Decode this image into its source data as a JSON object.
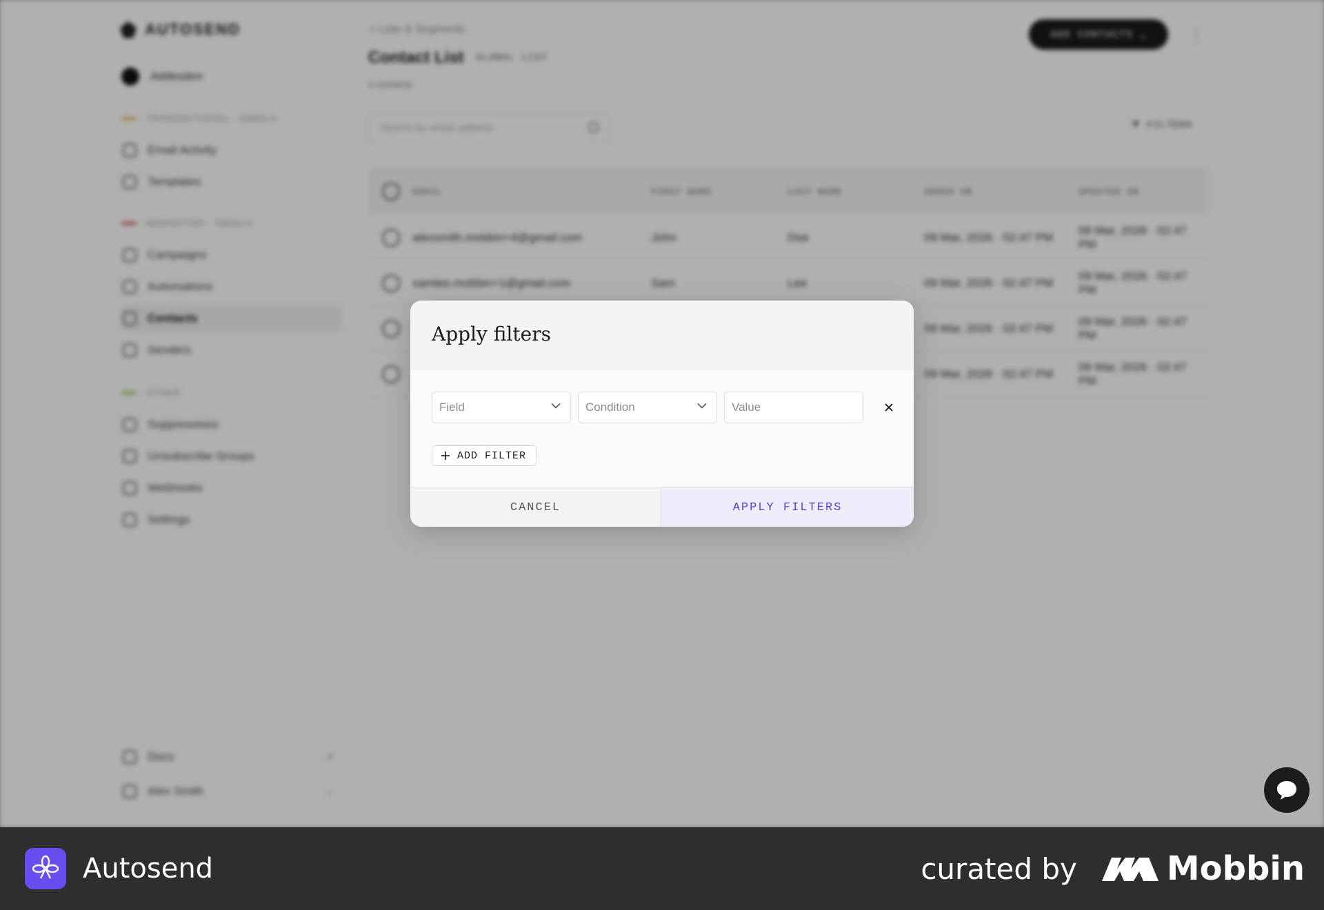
{
  "background": {
    "logo_text": "AUTOSEND",
    "user_name": "Addesdon",
    "sections": [
      {
        "label": "TRANSACTIONAL · EMAILS",
        "color": "#e0b340"
      },
      {
        "label": "MARKETING · EMAILS",
        "color": "#e04a4a"
      },
      {
        "label": "OTHER",
        "color": "#8bc34a"
      }
    ],
    "nav": [
      {
        "label": "Email Activity"
      },
      {
        "label": "Templates"
      },
      {
        "label": "Campaigns"
      },
      {
        "label": "Automations"
      },
      {
        "label": "Contacts"
      },
      {
        "label": "Senders"
      },
      {
        "label": "Suppressions"
      },
      {
        "label": "Unsubscribe Groups"
      },
      {
        "label": "Webhooks"
      },
      {
        "label": "Settings"
      }
    ],
    "bottom_nav": [
      {
        "label": "Docs",
        "badge": "↗"
      },
      {
        "label": "Alex Smith",
        "badge": "⌄"
      }
    ],
    "breadcrumb": "< Lists & Segments",
    "page_title": "Contact List",
    "title_tag": "GLOBAL LIST",
    "count_text": "4 contacts",
    "add_contacts_label": "ADD CONTACTS",
    "search_placeholder": "Search by email address",
    "filters_label": "FILTERS",
    "columns": [
      "EMAIL",
      "FIRST NAME",
      "LAST NAME",
      "ADDED ON",
      "UPDATED ON"
    ],
    "rows": [
      {
        "email": "alexsmith.mobbin+4@gmail.com",
        "first": "John",
        "last": "Doe",
        "added": "09 Mar, 2026 · 02:47 PM",
        "updated": "09 Mar, 2026 · 02:47 PM"
      },
      {
        "email": "samlee.mobbin+1@gmail.com",
        "first": "Sam",
        "last": "Lee",
        "added": "09 Mar, 2026 · 02:47 PM",
        "updated": "09 Mar, 2026 · 02:47 PM"
      },
      {
        "email": "",
        "first": "",
        "last": "",
        "added": "09 Mar, 2026 · 02:47 PM",
        "updated": "09 Mar, 2026 · 02:47 PM"
      },
      {
        "email": "",
        "first": "",
        "last": "",
        "added": "09 Mar, 2026 · 02:47 PM",
        "updated": "09 Mar, 2026 · 02:47 PM"
      }
    ]
  },
  "modal": {
    "title": "Apply filters",
    "field_placeholder": "Field",
    "condition_placeholder": "Condition",
    "value_placeholder": "Value",
    "add_filter_label": "ADD FILTER",
    "cancel_label": "CANCEL",
    "apply_label": "APPLY FILTERS"
  },
  "brand": {
    "app_name": "Autosend",
    "curated_by": "curated by",
    "mobbin": "Mobbin",
    "accent": "#6a4cf0"
  }
}
